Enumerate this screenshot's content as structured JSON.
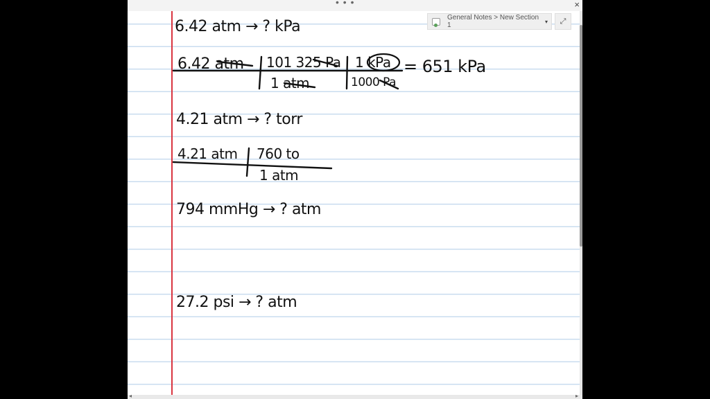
{
  "window": {
    "drag_handle": "• • •",
    "close_glyph": "×"
  },
  "breadcrumb": {
    "text": "General Notes > New Section 1",
    "caret": "▾",
    "icon": "notebook-icon"
  },
  "expand_glyph": "⤢",
  "scroll_arrows": {
    "left": "◂",
    "right": "▸"
  },
  "notes": {
    "p1_line": "6.42 atm → ? kPa",
    "p1_num1": "6.42 atm",
    "p1_num2": "101 325 Pa",
    "p1_num3": "1 kPa",
    "p1_den2": "1 atm",
    "p1_den3": "1000 Pa",
    "p1_result": "= 651 kPa",
    "p2_line": "4.21 atm → ? torr",
    "p2_num1": "4.21 atm",
    "p2_num2": "760 to",
    "p2_den2": "1 atm",
    "p3_line": "794 mmHg → ? atm",
    "p4_line": "27.2 psi → ? atm"
  }
}
